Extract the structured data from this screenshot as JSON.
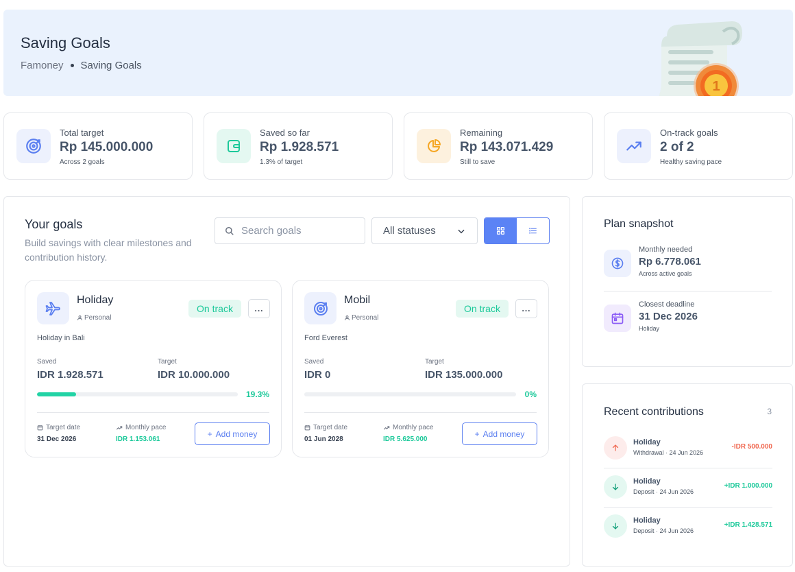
{
  "header": {
    "title": "Saving Goals",
    "breadcrumb": [
      "Famoney",
      "Saving Goals"
    ],
    "illustration_badge": "1"
  },
  "stats": [
    {
      "icon": "target-icon",
      "label": "Total target",
      "value": "Rp 145.000.000",
      "sub": "Across 2 goals",
      "color": "#5b7ff0",
      "bg": "#edf1fd"
    },
    {
      "icon": "wallet-icon",
      "label": "Saved so far",
      "value": "Rp 1.928.571",
      "sub": "1.3% of target",
      "color": "#1cc99a",
      "bg": "#e4f8f1"
    },
    {
      "icon": "pie-chart-icon",
      "label": "Remaining",
      "value": "Rp 143.071.429",
      "sub": "Still to save",
      "color": "#f5a623",
      "bg": "#fdf1de"
    },
    {
      "icon": "trending-up-icon",
      "label": "On-track goals",
      "value": "2 of 2",
      "sub": "Healthy saving pace",
      "color": "#5b7ff0",
      "bg": "#edf1fd"
    }
  ],
  "goals": {
    "title": "Your goals",
    "description": "Build savings with clear milestones and contribution history.",
    "search_placeholder": "Search goals",
    "status_filter": "All statuses",
    "cards": [
      {
        "icon": "plane-icon",
        "name": "Holiday",
        "category": "Personal",
        "status": "On track",
        "more": "...",
        "description": "Holiday in Bali",
        "saved_label": "Saved",
        "saved": "IDR 1.928.571",
        "target_label": "Target",
        "target": "IDR 10.000.000",
        "progress": 0.193,
        "progress_label": "19.3%",
        "date_label": "Target date",
        "date": "31 Dec 2026",
        "pace_label": "Monthly pace",
        "pace": "IDR 1.153.061",
        "add_label": "Add money"
      },
      {
        "icon": "target-icon",
        "name": "Mobil",
        "category": "Personal",
        "status": "On track",
        "more": "...",
        "description": "Ford Everest",
        "saved_label": "Saved",
        "saved": "IDR 0",
        "target_label": "Target",
        "target": "IDR 135.000.000",
        "progress": 0,
        "progress_label": "0%",
        "date_label": "Target date",
        "date": "01 Jun 2028",
        "pace_label": "Monthly pace",
        "pace": "IDR 5.625.000",
        "add_label": "Add money"
      }
    ]
  },
  "plan": {
    "title": "Plan snapshot",
    "items": [
      {
        "icon": "dollar-icon",
        "label": "Monthly needed",
        "value": "Rp 6.778.061",
        "sub": "Across active goals"
      },
      {
        "icon": "calendar-icon",
        "label": "Closest deadline",
        "value": "31 Dec 2026",
        "sub": "Holiday"
      }
    ]
  },
  "recent": {
    "title": "Recent contributions",
    "count": "3",
    "items": [
      {
        "type": "withdrawal",
        "icon": "arrow-up-icon",
        "name": "Holiday",
        "sub": "Withdrawal · 24 Jun 2026",
        "amount": "-IDR 500.000"
      },
      {
        "type": "deposit",
        "icon": "arrow-down-icon",
        "name": "Holiday",
        "sub": "Deposit · 24 Jun 2026",
        "amount": "+IDR 1.000.000"
      },
      {
        "type": "deposit",
        "icon": "arrow-down-icon",
        "name": "Holiday",
        "sub": "Deposit · 24 Jun 2026",
        "amount": "+IDR 1.428.571"
      }
    ]
  },
  "colors": {
    "accent": "#5b7ff0",
    "success": "#1cc99a",
    "danger": "#f0674f",
    "header_bg": "#eaf2fd"
  }
}
